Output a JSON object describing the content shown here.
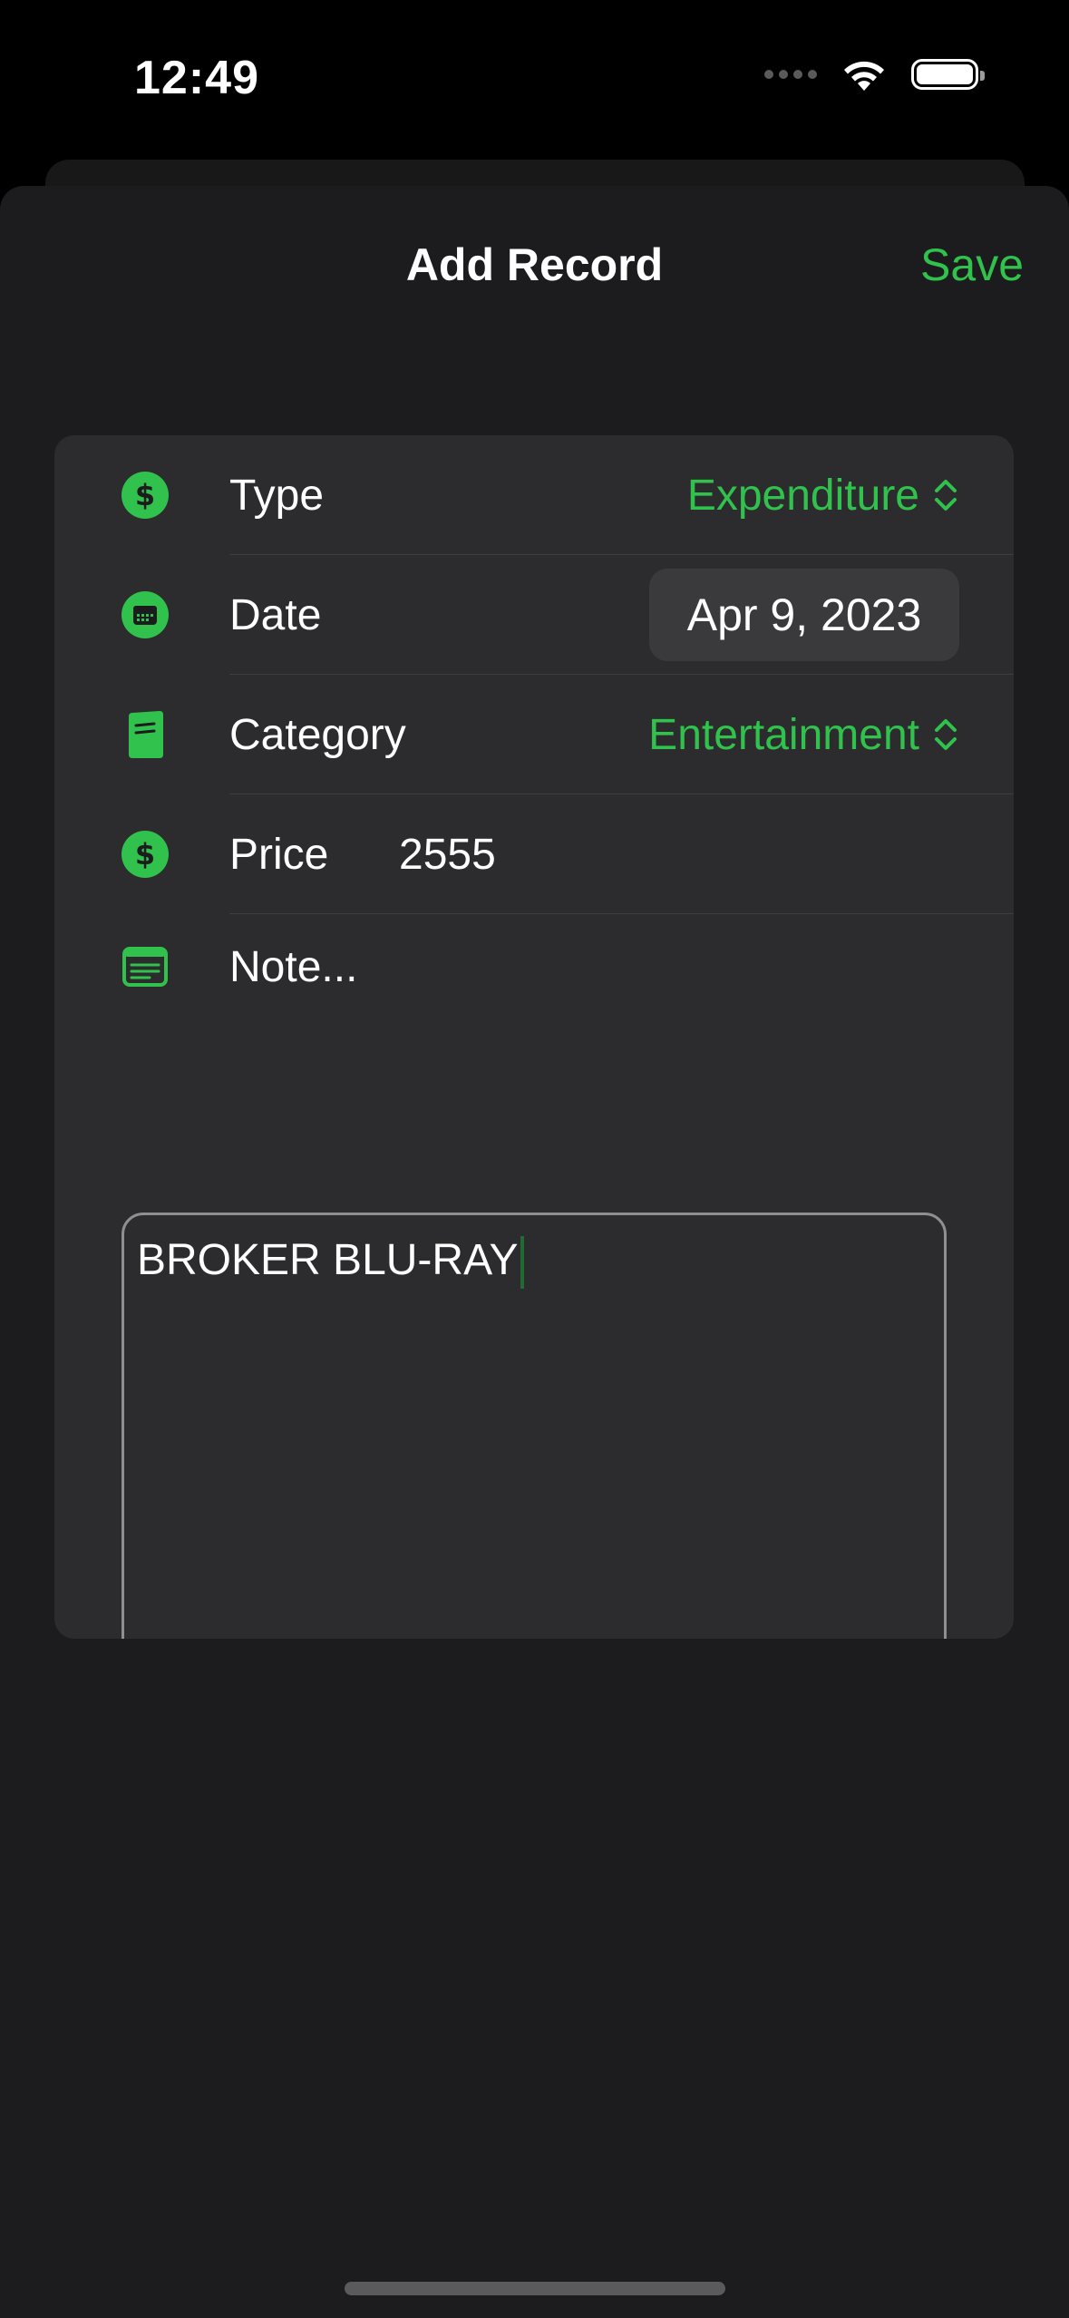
{
  "status_bar": {
    "time": "12:49"
  },
  "sheet": {
    "title": "Add Record",
    "save_label": "Save"
  },
  "form": {
    "type": {
      "label": "Type",
      "value": "Expenditure",
      "icon": "dollar-circle-icon"
    },
    "date": {
      "label": "Date",
      "value": "Apr 9, 2023",
      "icon": "calendar-icon"
    },
    "category": {
      "label": "Category",
      "value": "Entertainment",
      "icon": "book-icon"
    },
    "price": {
      "label": "Price",
      "value": "2555",
      "icon": "dollar-circle-icon"
    },
    "note": {
      "placeholder": "Note...",
      "text": "BROKER BLU-RAY",
      "icon": "note-icon"
    }
  },
  "colors": {
    "accent": "#30c24c",
    "background": "#1c1c1e",
    "card": "#2c2c2e"
  }
}
